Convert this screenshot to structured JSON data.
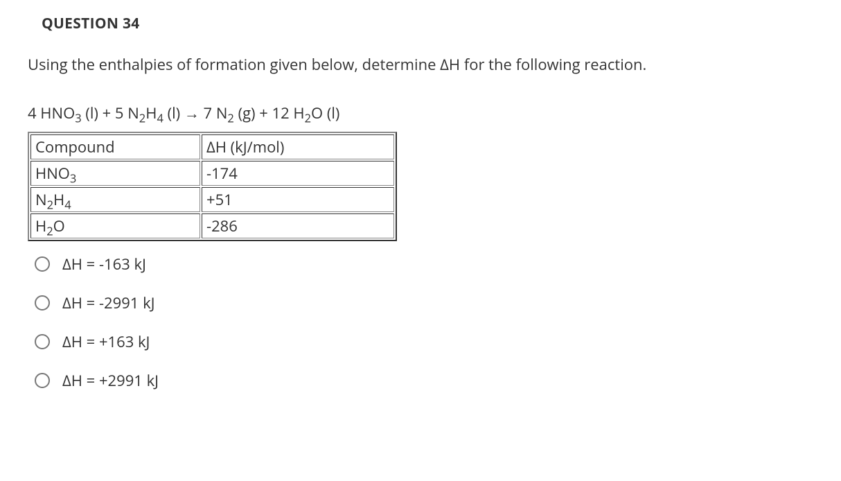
{
  "header": "QUESTION 34",
  "question_text": "Using the enthalpies of formation given below, determine ΔH for the following reaction.",
  "equation": {
    "plain": "4 HNO3 (l) + 5 N2H4 (l) → 7 N2 (g) + 12 H2O (l)"
  },
  "table": {
    "headers": {
      "col1": "Compound",
      "col2": "ΔH (kJ/mol)"
    },
    "rows": [
      {
        "compound_plain": "HNO3",
        "value": "-174"
      },
      {
        "compound_plain": "N2H4",
        "value": "+51"
      },
      {
        "compound_plain": "H2O",
        "value": "-286"
      }
    ]
  },
  "options": [
    {
      "label": "ΔH = -163 kJ"
    },
    {
      "label": "ΔH = -2991 kJ"
    },
    {
      "label": "ΔH = +163 kJ"
    },
    {
      "label": "ΔH = +2991 kJ"
    }
  ]
}
